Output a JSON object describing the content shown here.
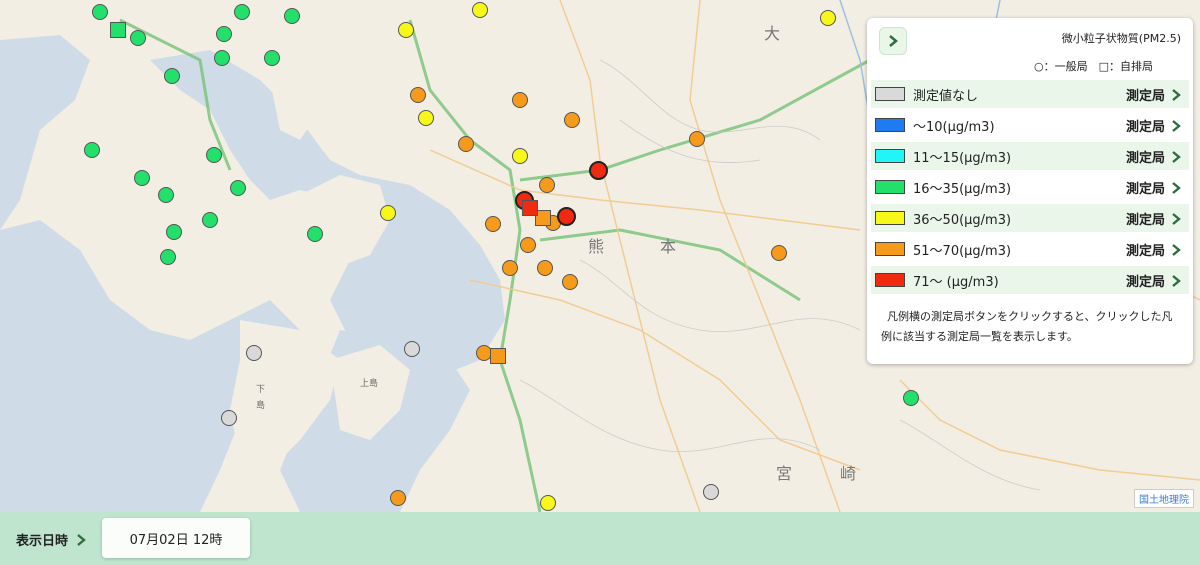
{
  "legend": {
    "title": "微小粒子状物質(PM2.5)",
    "types_text": "○：一般局　□：自排局",
    "toggle_icon": "chevron-right-icon",
    "items": [
      {
        "color": "#d9d9d9",
        "label": "測定値なし",
        "button": "測定局"
      },
      {
        "color": "#1e7cf0",
        "label": "〜10(μg/m3)",
        "button": "測定局"
      },
      {
        "color": "#21f5f5",
        "label": "11〜15(μg/m3)",
        "button": "測定局"
      },
      {
        "color": "#22e06a",
        "label": "16〜35(μg/m3)",
        "button": "測定局"
      },
      {
        "color": "#f7f71a",
        "label": "36〜50(μg/m3)",
        "button": "測定局"
      },
      {
        "color": "#f59a1a",
        "label": "51〜70(μg/m3)",
        "button": "測定局"
      },
      {
        "color": "#f02a10",
        "label": "71〜 (μg/m3)",
        "button": "測定局"
      }
    ],
    "note": "凡例横の測定局ボタンをクリックすると、クリックした凡例に該当する測定局一覧を表示します。"
  },
  "datetime": {
    "label": "表示日時",
    "value": "07月02日 12時"
  },
  "attribution": "国土地理院",
  "map_labels": {
    "kumamoto": "熊",
    "hon": "本",
    "miya": "宮",
    "saki": "崎",
    "oita": "大",
    "shimo": "下",
    "shima": "島",
    "kamiamakusa": "上島"
  },
  "colors": {
    "gray": "#d9d9d9",
    "green": "#22e06a",
    "yellow": "#f7f71a",
    "orange": "#f59a1a",
    "red": "#f02a10",
    "sea": "#cfdce8",
    "land": "#f2eee4",
    "bottom_bar": "#bfe5cf"
  }
}
